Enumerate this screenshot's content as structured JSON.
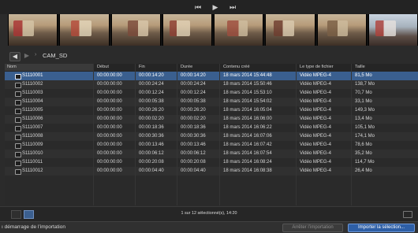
{
  "transport": {
    "prev_icon": "prev-icon",
    "play_icon": "play-icon",
    "next_icon": "next-icon"
  },
  "path": {
    "back_icon": "back-icon",
    "forward_icon": "forward-icon",
    "folder_icon": "folder-icon",
    "label": "CAM_SD"
  },
  "table": {
    "columns": {
      "name": "Nom",
      "start": "Début",
      "end": "Fin",
      "duration": "Durée",
      "created": "Contenu créé",
      "type": "Le type de fichier",
      "size": "Taille"
    },
    "rows": [
      {
        "name": "S1110001",
        "start": "00:00:00:00",
        "end": "00:00:14:20",
        "duration": "00:00:14:20",
        "created": "18 mars 2014 15:44:48",
        "type": "Vidéo MPEG-4",
        "size": "81,5 Mo"
      },
      {
        "name": "S1110002",
        "start": "00:00:00:00",
        "end": "00:00:24:24",
        "duration": "00:00:24:24",
        "created": "18 mars 2014 15:50:46",
        "type": "Vidéo MPEG-4",
        "size": "138,7 Mo"
      },
      {
        "name": "S1110003",
        "start": "00:00:00:00",
        "end": "00:00:12:24",
        "duration": "00:00:12:24",
        "created": "18 mars 2014 15:53:10",
        "type": "Vidéo MPEG-4",
        "size": "70,7 Mo"
      },
      {
        "name": "S1110004",
        "start": "00:00:00:00",
        "end": "00:00:05:38",
        "duration": "00:00:05:38",
        "created": "18 mars 2014 15:54:02",
        "type": "Vidéo MPEG-4",
        "size": "33,1 Mo"
      },
      {
        "name": "S1110005",
        "start": "00:00:00:00",
        "end": "00:00:26:20",
        "duration": "00:00:26:20",
        "created": "18 mars 2014 16:05:04",
        "type": "Vidéo MPEG-4",
        "size": "149,3 Mo"
      },
      {
        "name": "S1110006",
        "start": "00:00:00:00",
        "end": "00:00:02:20",
        "duration": "00:00:02:20",
        "created": "18 mars 2014 16:06:00",
        "type": "Vidéo MPEG-4",
        "size": "13,4 Mo"
      },
      {
        "name": "S1110007",
        "start": "00:00:00:00",
        "end": "00:00:18:36",
        "duration": "00:00:18:36",
        "created": "18 mars 2014 16:06:22",
        "type": "Vidéo MPEG-4",
        "size": "105,1 Mo"
      },
      {
        "name": "S1110008",
        "start": "00:00:00:00",
        "end": "00:00:30:36",
        "duration": "00:00:30:36",
        "created": "18 mars 2014 16:07:06",
        "type": "Vidéo MPEG-4",
        "size": "174,1 Mo"
      },
      {
        "name": "S1110009",
        "start": "00:00:00:00",
        "end": "00:00:13:46",
        "duration": "00:00:13:46",
        "created": "18 mars 2014 16:07:42",
        "type": "Vidéo MPEG-4",
        "size": "78,6 Mo"
      },
      {
        "name": "S1110010",
        "start": "00:00:00:00",
        "end": "00:00:06:12",
        "duration": "00:00:06:12",
        "created": "18 mars 2014 16:07:54",
        "type": "Vidéo MPEG-4",
        "size": "35,2 Mo"
      },
      {
        "name": "S1110011",
        "start": "00:00:00:00",
        "end": "00:00:20:08",
        "duration": "00:00:20:08",
        "created": "18 mars 2014 16:08:24",
        "type": "Vidéo MPEG-4",
        "size": "114,7 Mo"
      },
      {
        "name": "S1110012",
        "start": "00:00:00:00",
        "end": "00:00:04:40",
        "duration": "00:00:04:40",
        "created": "18 mars 2014 16:08:38",
        "type": "Vidéo MPEG-4",
        "size": "26,4 Mo"
      }
    ]
  },
  "footer": {
    "list_view_icon": "list-view-icon",
    "filmstrip_view_icon": "filmstrip-view-icon",
    "selection_count": "1 sur 12 sélectionné(s), 14:20",
    "zoom_icon": "zoom-icon"
  },
  "bottom": {
    "start_label": "ı démarrage de l’importation",
    "stop_button": "Arrêter l’importation",
    "import_button": "Importer la sélection..."
  },
  "colors": {
    "selection": "#3a5f8f",
    "import_button": "#2e5fa6"
  }
}
